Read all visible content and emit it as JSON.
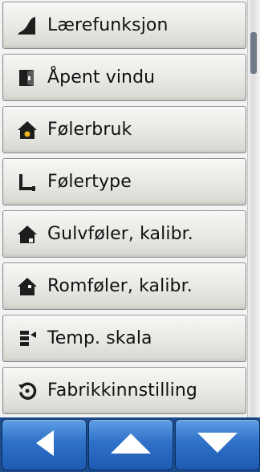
{
  "menu": {
    "items": [
      {
        "label": "Lærefunksjon",
        "icon": "learn-ramp-icon"
      },
      {
        "label": "Åpent vindu",
        "icon": "open-window-icon"
      },
      {
        "label": "Følerbruk",
        "icon": "house-sensor-icon"
      },
      {
        "label": "Følertype",
        "icon": "sensor-type-icon"
      },
      {
        "label": "Gulvføler, kalibr.",
        "icon": "house-floor-icon"
      },
      {
        "label": "Romføler, kalibr.",
        "icon": "house-room-icon"
      },
      {
        "label": "Temp. skala",
        "icon": "temp-scale-icon"
      },
      {
        "label": "Fabrikkinnstilling",
        "icon": "factory-reset-icon"
      }
    ]
  },
  "navigation": {
    "buttons": [
      {
        "icon": "arrow-left-icon"
      },
      {
        "icon": "arrow-up-icon"
      },
      {
        "icon": "arrow-down-icon"
      }
    ]
  },
  "colors": {
    "icon": "#1d1d1d",
    "icon_accent": "#f0b51a",
    "nav_bar": "#1c4d8e",
    "nav_button": "#2f70c8",
    "arrow": "#ffffff",
    "scroll_thumb": "#6f7a88"
  }
}
